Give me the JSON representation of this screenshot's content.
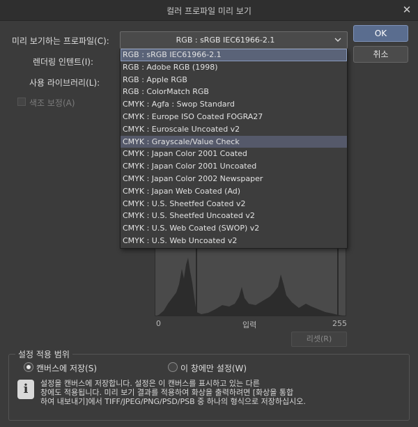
{
  "window": {
    "title": "컬러 프로파일 미리 보기",
    "close_icon": "close-icon"
  },
  "form": {
    "profile_label": "미리 보기하는 프로파일(C):",
    "profile_value": "RGB : sRGB IEC61966-2.1",
    "intent_label": "렌더링 인텐트(I):",
    "library_label": "사용 라이브러리(L):",
    "tone_label": "색조 보정(A)"
  },
  "dropdown": {
    "items": [
      "RGB : sRGB IEC61966-2.1",
      "RGB : Adobe RGB (1998)",
      "RGB : Apple RGB",
      "RGB : ColorMatch RGB",
      "CMYK : Agfa : Swop Standard",
      "CMYK : Europe ISO Coated FOGRA27",
      "CMYK : Euroscale Uncoated v2",
      "CMYK : Grayscale/Value Check",
      "CMYK : Japan Color 2001 Coated",
      "CMYK : Japan Color 2001 Uncoated",
      "CMYK : Japan Color 2002 Newspaper",
      "CMYK : Japan Web Coated (Ad)",
      "CMYK : U.S. Sheetfed Coated v2",
      "CMYK : U.S. Sheetfed Uncoated v2",
      "CMYK : U.S. Web Coated (SWOP) v2",
      "CMYK : U.S. Web Uncoated v2"
    ],
    "selected_index": 0,
    "hover_index": 7
  },
  "buttons": {
    "ok": "OK",
    "cancel": "취소",
    "reset": "리셋(R)"
  },
  "histogram": {
    "x_min": "0",
    "x_label": "입력",
    "x_max": "255"
  },
  "scope": {
    "title": "설정 적용 범위",
    "option1": "캔버스에 저장(S)",
    "option2": "이 창에만 설정(W)",
    "selected": "option1"
  },
  "info": {
    "icon": "info-icon",
    "line1": "설정을 캔버스에 저장합니다. 설정은 이 캔버스를 표시하고 있는 다른",
    "line2": "창에도 적용됩니다. 미리 보기 결과를 적용하여 화상을 출력하려면 [화상을 통합",
    "line3": "하여 내보내기]에서 TIFF/JPEG/PNG/PSD/PSB 중 하나의 형식으로 저장하십시오."
  },
  "colors": {
    "background": "#3b3b3b",
    "accent": "#5a6d8f",
    "selection": "#5a6378"
  }
}
